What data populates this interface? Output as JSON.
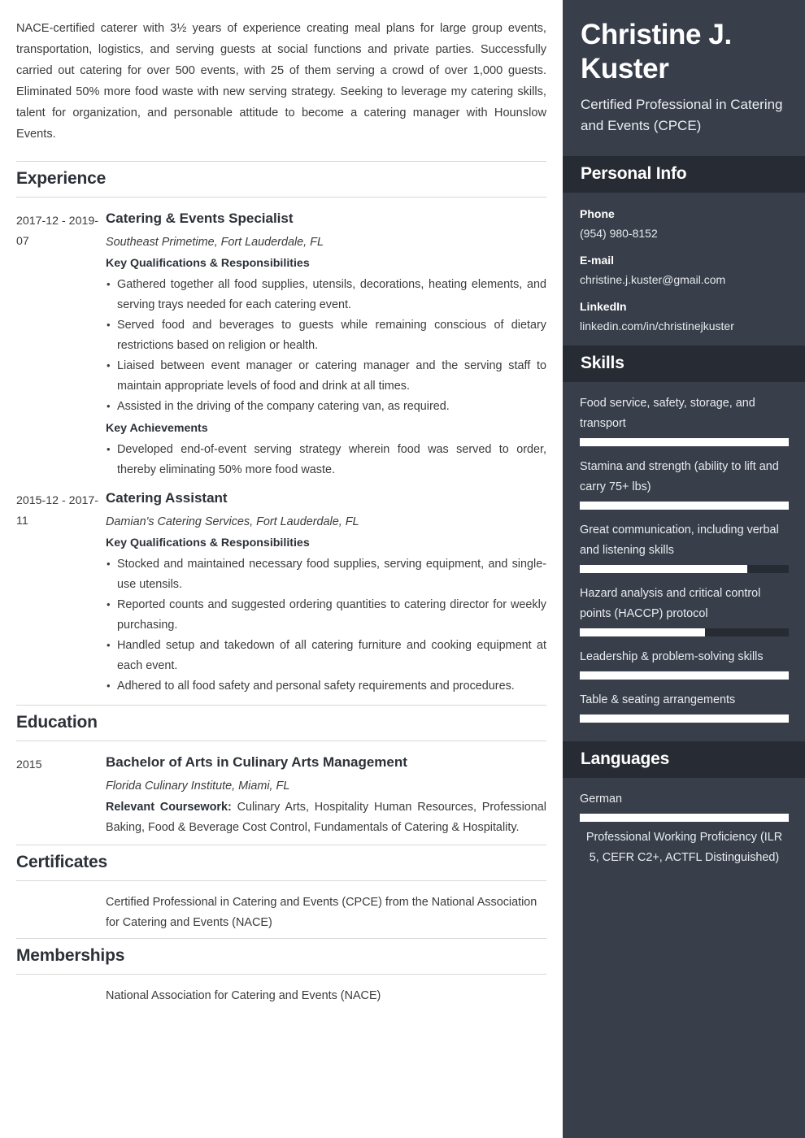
{
  "summary": "NACE-certified caterer with 3½ years of experience creating meal plans for large group events, transportation, logistics, and serving guests at social functions and private parties. Successfully carried out catering for over 500 events, with 25 of them serving a crowd of over 1,000 guests. Eliminated 50% more food waste with new serving strategy. Seeking to leverage my catering skills, talent for organization, and personable attitude to become a catering manager with Hounslow Events.",
  "sections": {
    "experience_heading": "Experience",
    "education_heading": "Education",
    "certificates_heading": "Certificates",
    "memberships_heading": "Memberships"
  },
  "experience": [
    {
      "date": "2017-12 - 2019-07",
      "title": "Catering & Events Specialist",
      "org": "Southeast Primetime, Fort Lauderdale, FL",
      "qual_heading": "Key Qualifications & Responsibilities",
      "quals": [
        "Gathered together all food supplies, utensils, decorations, heating elements, and serving trays needed for each catering event.",
        "Served food and beverages to guests while remaining conscious of dietary restrictions based on religion or health.",
        "Liaised between event manager or catering manager and the serving staff to maintain appropriate levels of food and drink at all times.",
        "Assisted in the driving of the company catering van, as required."
      ],
      "ach_heading": "Key Achievements",
      "achievements": [
        "Developed end-of-event serving strategy wherein food was served to order, thereby eliminating 50% more food waste."
      ]
    },
    {
      "date": "2015-12 - 2017-11",
      "title": "Catering Assistant",
      "org": "Damian's Catering Services, Fort Lauderdale, FL",
      "qual_heading": "Key Qualifications & Responsibilities",
      "quals": [
        "Stocked and maintained necessary food supplies, serving equipment, and single-use utensils.",
        "Reported counts and suggested ordering quantities to catering director for weekly purchasing.",
        "Handled setup and takedown of all catering furniture and cooking equipment at each event.",
        "Adhered to all food safety and personal safety requirements and procedures."
      ],
      "ach_heading": "",
      "achievements": []
    }
  ],
  "education": [
    {
      "date": "2015",
      "title": "Bachelor of Arts in Culinary Arts Management",
      "org": "Florida Culinary Institute, Miami, FL",
      "coursework_label": "Relevant Coursework:",
      "coursework": " Culinary Arts, Hospitality Human Resources, Professional Baking, Food & Beverage Cost Control, Fundamentals of Catering & Hospitality."
    }
  ],
  "certificates": [
    "Certified Professional in Catering and Events (CPCE) from the National Association for Catering and Events (NACE)"
  ],
  "memberships": [
    "National Association for Catering and Events (NACE)"
  ],
  "sidebar": {
    "name": "Christine J. Kuster",
    "job_title": "Certified Professional in Catering and Events (CPCE)",
    "personal_info": {
      "heading": "Personal Info",
      "phone_label": "Phone",
      "phone": "(954) 980-8152",
      "email_label": "E-mail",
      "email": "christine.j.kuster@gmail.com",
      "linkedin_label": "LinkedIn",
      "linkedin": "linkedin.com/in/christinejkuster"
    },
    "skills": {
      "heading": "Skills",
      "items": [
        {
          "name": "Food service, safety, storage, and transport",
          "level": 100
        },
        {
          "name": "Stamina and strength (ability to lift and carry 75+ lbs)",
          "level": 100
        },
        {
          "name": "Great communication, including verbal and listening skills",
          "level": 80
        },
        {
          "name": "Hazard analysis and critical control points (HACCP) protocol",
          "level": 60
        },
        {
          "name": "Leadership & problem-solving skills",
          "level": 100
        },
        {
          "name": "Table & seating arrangements",
          "level": 100
        }
      ]
    },
    "languages": {
      "heading": "Languages",
      "items": [
        {
          "name": "German",
          "level": 100,
          "proficiency": "Professional Working Proficiency (ILR 5, CEFR C2+, ACTFL Distinguished)"
        }
      ]
    }
  },
  "colors": {
    "sidebar_bg": "#383e4a",
    "sidebar_header_bg": "#272b33",
    "heading_text": "#2c3038",
    "body_text": "#3b3b3b",
    "bar_fill": "#ffffff"
  }
}
